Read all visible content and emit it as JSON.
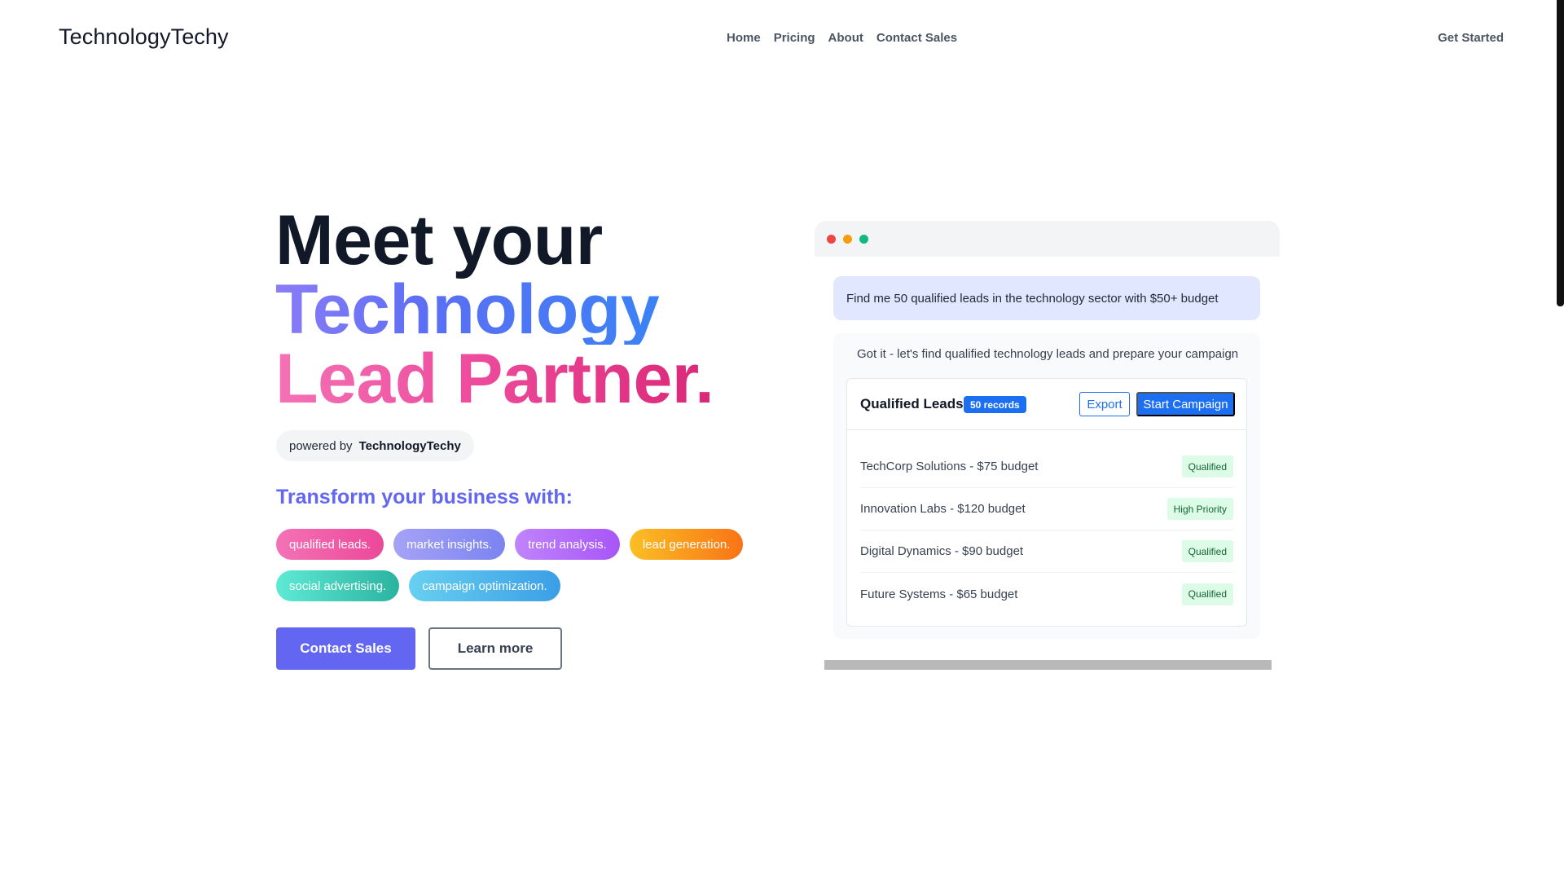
{
  "header": {
    "brand": "TechnologyTechy",
    "nav": [
      {
        "label": "Home"
      },
      {
        "label": "Pricing"
      },
      {
        "label": "About"
      },
      {
        "label": "Contact Sales"
      }
    ],
    "cta": "Get Started"
  },
  "hero": {
    "line1": "Meet your",
    "line2": "Technology",
    "line3": "Lead Partner.",
    "powered_prefix": "powered by",
    "powered_brand": "TechnologyTechy",
    "subtitle": "Transform your business with:",
    "pills": [
      {
        "label": "qualified leads."
      },
      {
        "label": "market insights."
      },
      {
        "label": "trend analysis."
      },
      {
        "label": "lead generation."
      },
      {
        "label": "social advertising."
      },
      {
        "label": "campaign optimization."
      }
    ],
    "primary_button": "Contact Sales",
    "secondary_button": "Learn more"
  },
  "demo": {
    "user_message": "Find me 50 qualified leads in the technology sector with $50+ budget",
    "assistant_message": "Got it - let's find qualified technology leads and prepare your campaign",
    "card": {
      "title": "Qualified Leads",
      "badge": "50 records",
      "export_label": "Export",
      "campaign_label": "Start Campaign",
      "leads": [
        {
          "name": "TechCorp Solutions - $75 budget",
          "status": "Qualified"
        },
        {
          "name": "Innovation Labs - $120 budget",
          "status": "High Priority"
        },
        {
          "name": "Digital Dynamics - $90 budget",
          "status": "Qualified"
        },
        {
          "name": "Future Systems - $65 budget",
          "status": "Qualified"
        }
      ]
    }
  },
  "colors": {
    "accent": "#6366f1",
    "primary_blue": "#1d6ff2",
    "status_bg": "#dcfce7",
    "status_text": "#166534"
  },
  "icons": {
    "window_controls": [
      "close-dot",
      "minimize-dot",
      "maximize-dot"
    ]
  }
}
